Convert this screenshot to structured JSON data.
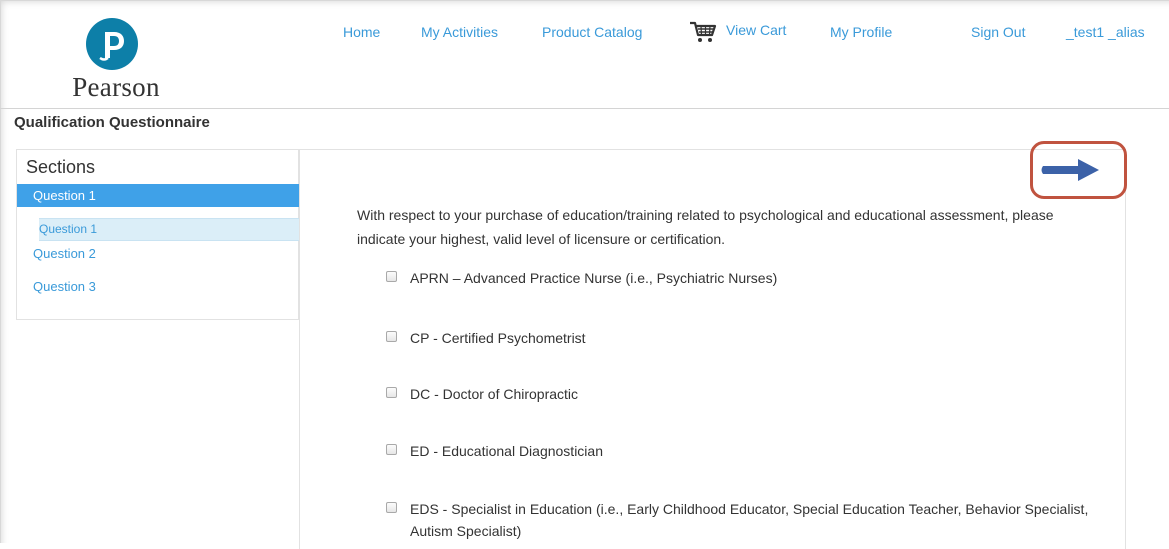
{
  "brand": {
    "logo_text": "Pearson",
    "color": "#0d7fa8"
  },
  "nav": {
    "home": "Home",
    "activities": "My Activities",
    "catalog": "Product Catalog",
    "cart": "View Cart",
    "profile": "My Profile",
    "signout": "Sign Out",
    "user": "_test1 _alias"
  },
  "page": {
    "title": "Qualification Questionnaire"
  },
  "sidebar": {
    "heading": "Sections",
    "active_section": "Question 1",
    "sub_items": [
      "Question 1"
    ],
    "items": [
      "Question 2",
      "Question 3"
    ]
  },
  "question": {
    "text": "With respect to your purchase of education/training related to psychological and educational assessment, please indicate your highest, valid level of licensure or certification."
  },
  "options": [
    "APRN – Advanced Practice Nurse (i.e., Psychiatric Nurses)",
    "CP - Certified Psychometrist",
    "DC - Doctor of Chiropractic",
    "ED - Educational Diagnostician",
    "EDS - Specialist in Education (i.e., Early Childhood Educator, Special Education Teacher, Behavior Specialist, Autism Specialist)"
  ],
  "colors": {
    "link": "#3a9ad9",
    "active_section": "#3fa1e8",
    "highlight_border": "#c0533f",
    "arrow": "#3c62a8"
  },
  "icons": {
    "cart": "cart-icon",
    "next": "next-arrow-icon"
  }
}
